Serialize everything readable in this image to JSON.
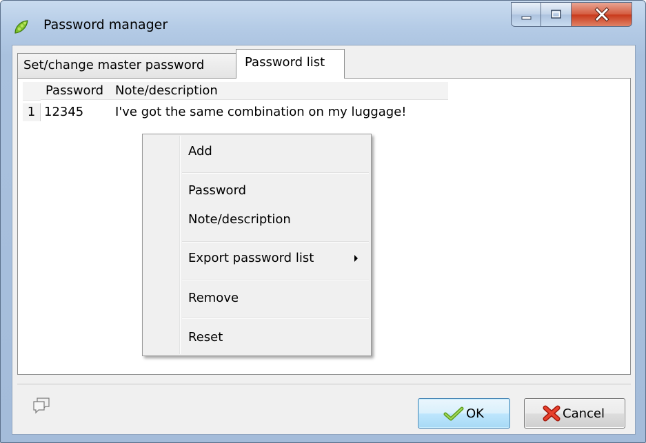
{
  "window": {
    "title": "Password manager",
    "icon": "pea-pod-icon"
  },
  "tabs": [
    {
      "label": "Set/change master password",
      "active": false
    },
    {
      "label": "Password list",
      "active": true
    }
  ],
  "table": {
    "columns": [
      "Password",
      "Note/description"
    ],
    "rows": [
      {
        "index": "1",
        "password": "12345",
        "note": "I've got the same combination on my luggage!"
      }
    ]
  },
  "context_menu": {
    "items": [
      {
        "label": "Add"
      },
      {
        "label": "Password"
      },
      {
        "label": "Note/description"
      },
      {
        "label": "Export password list",
        "has_submenu": true
      },
      {
        "label": "Remove"
      },
      {
        "label": "Reset"
      }
    ]
  },
  "footer": {
    "ok_label": "OK",
    "cancel_label": "Cancel"
  },
  "colors": {
    "title_bar": "#b4cbe6",
    "close_button": "#c8381a",
    "ok_button": "#bee6fd"
  }
}
